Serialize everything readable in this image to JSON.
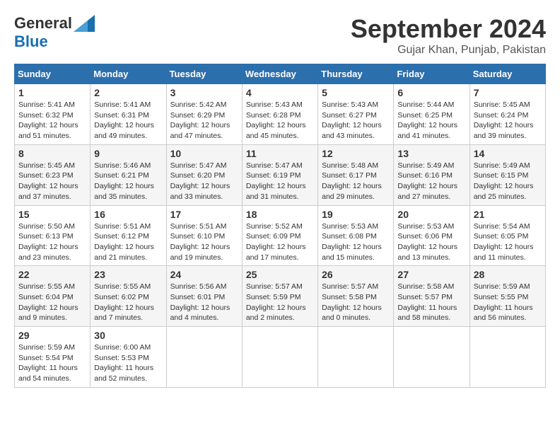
{
  "logo": {
    "general": "General",
    "blue": "Blue"
  },
  "title": "September 2024",
  "location": "Gujar Khan, Punjab, Pakistan",
  "headers": [
    "Sunday",
    "Monday",
    "Tuesday",
    "Wednesday",
    "Thursday",
    "Friday",
    "Saturday"
  ],
  "weeks": [
    [
      {
        "day": "1",
        "sunrise": "5:41 AM",
        "sunset": "6:32 PM",
        "daylight": "12 hours and 51 minutes."
      },
      {
        "day": "2",
        "sunrise": "5:41 AM",
        "sunset": "6:31 PM",
        "daylight": "12 hours and 49 minutes."
      },
      {
        "day": "3",
        "sunrise": "5:42 AM",
        "sunset": "6:29 PM",
        "daylight": "12 hours and 47 minutes."
      },
      {
        "day": "4",
        "sunrise": "5:43 AM",
        "sunset": "6:28 PM",
        "daylight": "12 hours and 45 minutes."
      },
      {
        "day": "5",
        "sunrise": "5:43 AM",
        "sunset": "6:27 PM",
        "daylight": "12 hours and 43 minutes."
      },
      {
        "day": "6",
        "sunrise": "5:44 AM",
        "sunset": "6:25 PM",
        "daylight": "12 hours and 41 minutes."
      },
      {
        "day": "7",
        "sunrise": "5:45 AM",
        "sunset": "6:24 PM",
        "daylight": "12 hours and 39 minutes."
      }
    ],
    [
      {
        "day": "8",
        "sunrise": "5:45 AM",
        "sunset": "6:23 PM",
        "daylight": "12 hours and 37 minutes."
      },
      {
        "day": "9",
        "sunrise": "5:46 AM",
        "sunset": "6:21 PM",
        "daylight": "12 hours and 35 minutes."
      },
      {
        "day": "10",
        "sunrise": "5:47 AM",
        "sunset": "6:20 PM",
        "daylight": "12 hours and 33 minutes."
      },
      {
        "day": "11",
        "sunrise": "5:47 AM",
        "sunset": "6:19 PM",
        "daylight": "12 hours and 31 minutes."
      },
      {
        "day": "12",
        "sunrise": "5:48 AM",
        "sunset": "6:17 PM",
        "daylight": "12 hours and 29 minutes."
      },
      {
        "day": "13",
        "sunrise": "5:49 AM",
        "sunset": "6:16 PM",
        "daylight": "12 hours and 27 minutes."
      },
      {
        "day": "14",
        "sunrise": "5:49 AM",
        "sunset": "6:15 PM",
        "daylight": "12 hours and 25 minutes."
      }
    ],
    [
      {
        "day": "15",
        "sunrise": "5:50 AM",
        "sunset": "6:13 PM",
        "daylight": "12 hours and 23 minutes."
      },
      {
        "day": "16",
        "sunrise": "5:51 AM",
        "sunset": "6:12 PM",
        "daylight": "12 hours and 21 minutes."
      },
      {
        "day": "17",
        "sunrise": "5:51 AM",
        "sunset": "6:10 PM",
        "daylight": "12 hours and 19 minutes."
      },
      {
        "day": "18",
        "sunrise": "5:52 AM",
        "sunset": "6:09 PM",
        "daylight": "12 hours and 17 minutes."
      },
      {
        "day": "19",
        "sunrise": "5:53 AM",
        "sunset": "6:08 PM",
        "daylight": "12 hours and 15 minutes."
      },
      {
        "day": "20",
        "sunrise": "5:53 AM",
        "sunset": "6:06 PM",
        "daylight": "12 hours and 13 minutes."
      },
      {
        "day": "21",
        "sunrise": "5:54 AM",
        "sunset": "6:05 PM",
        "daylight": "12 hours and 11 minutes."
      }
    ],
    [
      {
        "day": "22",
        "sunrise": "5:55 AM",
        "sunset": "6:04 PM",
        "daylight": "12 hours and 9 minutes."
      },
      {
        "day": "23",
        "sunrise": "5:55 AM",
        "sunset": "6:02 PM",
        "daylight": "12 hours and 7 minutes."
      },
      {
        "day": "24",
        "sunrise": "5:56 AM",
        "sunset": "6:01 PM",
        "daylight": "12 hours and 4 minutes."
      },
      {
        "day": "25",
        "sunrise": "5:57 AM",
        "sunset": "5:59 PM",
        "daylight": "12 hours and 2 minutes."
      },
      {
        "day": "26",
        "sunrise": "5:57 AM",
        "sunset": "5:58 PM",
        "daylight": "12 hours and 0 minutes."
      },
      {
        "day": "27",
        "sunrise": "5:58 AM",
        "sunset": "5:57 PM",
        "daylight": "11 hours and 58 minutes."
      },
      {
        "day": "28",
        "sunrise": "5:59 AM",
        "sunset": "5:55 PM",
        "daylight": "11 hours and 56 minutes."
      }
    ],
    [
      {
        "day": "29",
        "sunrise": "5:59 AM",
        "sunset": "5:54 PM",
        "daylight": "11 hours and 54 minutes."
      },
      {
        "day": "30",
        "sunrise": "6:00 AM",
        "sunset": "5:53 PM",
        "daylight": "11 hours and 52 minutes."
      },
      null,
      null,
      null,
      null,
      null
    ]
  ]
}
